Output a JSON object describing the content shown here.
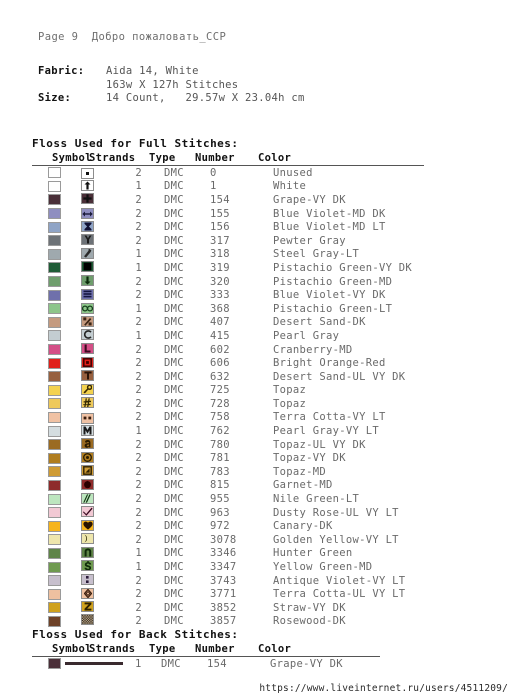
{
  "page_header": "Page 9  Добро пожаловать_CCP",
  "specs": [
    {
      "label": "Fabric:",
      "value": "Aida 14, White"
    },
    {
      "label": "",
      "value": "163w X 127h Stitches"
    },
    {
      "label": "Size:",
      "value": "14 Count,   29.57w X 23.04h cm"
    }
  ],
  "columns": [
    "Symbol",
    "Strands",
    "Type",
    "Number",
    "Color"
  ],
  "full_section": {
    "title": "Floss Used for Full Stitches:",
    "rows": [
      {
        "swatch": "#ffffff",
        "sym_bg": "#ffffff",
        "sym_fg": "#111111",
        "glyph": "dot",
        "strands": "2",
        "type": "DMC",
        "number": "0",
        "color": "Unused"
      },
      {
        "swatch": "#ffffff",
        "sym_bg": "#ffffff",
        "sym_fg": "#111111",
        "glyph": "arrow-up",
        "strands": "1",
        "type": "DMC",
        "number": "1",
        "color": "White"
      },
      {
        "swatch": "#4a2f38",
        "sym_bg": "#4a2f38",
        "sym_fg": "#111111",
        "glyph": "plus",
        "strands": "2",
        "type": "DMC",
        "number": "154",
        "color": "Grape-VY DK"
      },
      {
        "swatch": "#8f8ec0",
        "sym_bg": "#8f8ec0",
        "sym_fg": "#1a1a3a",
        "glyph": "double-arrow",
        "strands": "2",
        "type": "DMC",
        "number": "155",
        "color": "Blue Violet-MD DK"
      },
      {
        "swatch": "#8fa4c6",
        "sym_bg": "#8fa4c6",
        "sym_fg": "#111133",
        "glyph": "hourglass",
        "strands": "2",
        "type": "DMC",
        "number": "156",
        "color": "Blue Violet-MD LT"
      },
      {
        "swatch": "#6d7277",
        "sym_bg": "#6d7277",
        "sym_fg": "#1a1a1a",
        "glyph": "y-letter",
        "strands": "2",
        "type": "DMC",
        "number": "317",
        "color": "Pewter Gray"
      },
      {
        "swatch": "#9fa9ae",
        "sym_bg": "#9fa9ae",
        "sym_fg": "#2a2a2a",
        "glyph": "diagonal",
        "strands": "1",
        "type": "DMC",
        "number": "318",
        "color": "Steel Gray-LT"
      },
      {
        "swatch": "#1f5c36",
        "sym_bg": "#1f5c36",
        "sym_fg": "#000000",
        "glyph": "filled-square",
        "strands": "1",
        "type": "DMC",
        "number": "319",
        "color": "Pistachio Green-VY DK"
      },
      {
        "swatch": "#6f9e6d",
        "sym_bg": "#6f9e6d",
        "sym_fg": "#0a2a0a",
        "glyph": "arrow-down",
        "strands": "2",
        "type": "DMC",
        "number": "320",
        "color": "Pistachio Green-MD"
      },
      {
        "swatch": "#6f70ab",
        "sym_bg": "#6f70ab",
        "sym_fg": "#151540",
        "glyph": "bars",
        "strands": "2",
        "type": "DMC",
        "number": "333",
        "color": "Blue Violet-VY DK"
      },
      {
        "swatch": "#8dc58a",
        "sym_bg": "#8dc58a",
        "sym_fg": "#14401a",
        "glyph": "infinity",
        "strands": "1",
        "type": "DMC",
        "number": "368",
        "color": "Pistachio Green-LT"
      },
      {
        "swatch": "#c49a7f",
        "sym_bg": "#c49a7f",
        "sym_fg": "#3a2414",
        "glyph": "percent",
        "strands": "2",
        "type": "DMC",
        "number": "407",
        "color": "Desert Sand-DK"
      },
      {
        "swatch": "#c3cdd1",
        "sym_bg": "#c3cdd1",
        "sym_fg": "#222222",
        "glyph": "c-letter",
        "strands": "1",
        "type": "DMC",
        "number": "415",
        "color": "Pearl Gray"
      },
      {
        "swatch": "#d44e86",
        "sym_bg": "#d44e86",
        "sym_fg": "#3a0a20",
        "glyph": "l-letter",
        "strands": "2",
        "type": "DMC",
        "number": "602",
        "color": "Cranberry-MD"
      },
      {
        "swatch": "#e0201a",
        "sym_bg": "#e0201a",
        "sym_fg": "#400000",
        "glyph": "box",
        "strands": "2",
        "type": "DMC",
        "number": "606",
        "color": "Bright Orange-Red"
      },
      {
        "swatch": "#97603f",
        "sym_bg": "#97603f",
        "sym_fg": "#2a1408",
        "glyph": "t-letter",
        "strands": "2",
        "type": "DMC",
        "number": "632",
        "color": "Desert Sand-UL VY DK"
      },
      {
        "swatch": "#f3d24f",
        "sym_bg": "#f3d24f",
        "sym_fg": "#3a2a00",
        "glyph": "key",
        "strands": "2",
        "type": "DMC",
        "number": "725",
        "color": "Topaz"
      },
      {
        "swatch": "#eec95a",
        "sym_bg": "#eec95a",
        "sym_fg": "#332800",
        "glyph": "hash",
        "strands": "2",
        "type": "DMC",
        "number": "728",
        "color": "Topaz"
      },
      {
        "swatch": "#f0c2a4",
        "sym_bg": "#f0c2a4",
        "sym_fg": "#3a1c0c",
        "glyph": "two-dots",
        "strands": "2",
        "type": "DMC",
        "number": "758",
        "color": "Terra Cotta-VY LT"
      },
      {
        "swatch": "#d4dde0",
        "sym_bg": "#d4dde0",
        "sym_fg": "#1a1a1a",
        "glyph": "m-letter",
        "strands": "1",
        "type": "DMC",
        "number": "762",
        "color": "Pearl Gray-VY LT"
      },
      {
        "swatch": "#9b6b22",
        "sym_bg": "#9b6b22",
        "sym_fg": "#2a1a00",
        "glyph": "a-letter",
        "strands": "2",
        "type": "DMC",
        "number": "780",
        "color": "Topaz-UL VY DK"
      },
      {
        "swatch": "#b07d1f",
        "sym_bg": "#b07d1f",
        "sym_fg": "#2a1c00",
        "glyph": "circle-dot",
        "strands": "2",
        "type": "DMC",
        "number": "781",
        "color": "Topaz-VY DK"
      },
      {
        "swatch": "#cf9b34",
        "sym_bg": "#cf9b34",
        "sym_fg": "#2e2000",
        "glyph": "corner-square",
        "strands": "2",
        "type": "DMC",
        "number": "783",
        "color": "Topaz-MD"
      },
      {
        "swatch": "#8e2b2b",
        "sym_bg": "#8e2b2b",
        "sym_fg": "#2a0000",
        "glyph": "blob",
        "strands": "2",
        "type": "DMC",
        "number": "815",
        "color": "Garnet-MD"
      },
      {
        "swatch": "#bde6bf",
        "sym_bg": "#bde6bf",
        "sym_fg": "#10360f",
        "glyph": "slashes",
        "strands": "2",
        "type": "DMC",
        "number": "955",
        "color": "Nile Green-LT"
      },
      {
        "swatch": "#f2c9d4",
        "sym_bg": "#f2c9d4",
        "sym_fg": "#3a0a20",
        "glyph": "check",
        "strands": "2",
        "type": "DMC",
        "number": "963",
        "color": "Dusty Rose-UL VY LT"
      },
      {
        "swatch": "#f6b41c",
        "sym_bg": "#f6b41c",
        "sym_fg": "#2a1400",
        "glyph": "heart",
        "strands": "2",
        "type": "DMC",
        "number": "972",
        "color": "Canary-DK"
      },
      {
        "swatch": "#eee6ac",
        "sym_bg": "#eee6ac",
        "sym_fg": "#2a2600",
        "glyph": "moon",
        "strands": "2",
        "type": "DMC",
        "number": "3078",
        "color": "Golden Yellow-VY LT"
      },
      {
        "swatch": "#5f8448",
        "sym_bg": "#5f8448",
        "sym_fg": "#0f2a08",
        "glyph": "n-letter",
        "strands": "1",
        "type": "DMC",
        "number": "3346",
        "color": "Hunter Green"
      },
      {
        "swatch": "#6f9a50",
        "sym_bg": "#6f9a50",
        "sym_fg": "#0f2a08",
        "glyph": "dollar",
        "strands": "1",
        "type": "DMC",
        "number": "3347",
        "color": "Yellow Green-MD"
      },
      {
        "swatch": "#c7bfcd",
        "sym_bg": "#c7bfcd",
        "sym_fg": "#2a1a3a",
        "glyph": "colon-box",
        "strands": "2",
        "type": "DMC",
        "number": "3743",
        "color": "Antique Violet-VY LT"
      },
      {
        "swatch": "#eec0a0",
        "sym_bg": "#eec0a0",
        "sym_fg": "#3a1c0c",
        "glyph": "diamond-o",
        "strands": "2",
        "type": "DMC",
        "number": "3771",
        "color": "Terra Cotta-UL VY LT"
      },
      {
        "swatch": "#cfa11d",
        "sym_bg": "#cfa11d",
        "sym_fg": "#2e2000",
        "glyph": "z-letter",
        "strands": "2",
        "type": "DMC",
        "number": "3852",
        "color": "Straw-VY DK"
      },
      {
        "swatch": "#6e4228",
        "sym_bg": "#6e4228",
        "sym_fg": "#1a0c04",
        "glyph": "crosshatch",
        "strands": "2",
        "type": "DMC",
        "number": "3857",
        "color": "Rosewood-DK"
      }
    ]
  },
  "back_section": {
    "title": "Floss Used for Back Stitches:",
    "rows": [
      {
        "swatch": "#4a2f38",
        "line_color": "#3a2a2f",
        "strands": "1",
        "type": "DMC",
        "number": "154",
        "color": "Grape-VY DK"
      }
    ]
  },
  "footer_url": "https://www.liveinternet.ru/users/4511209/"
}
